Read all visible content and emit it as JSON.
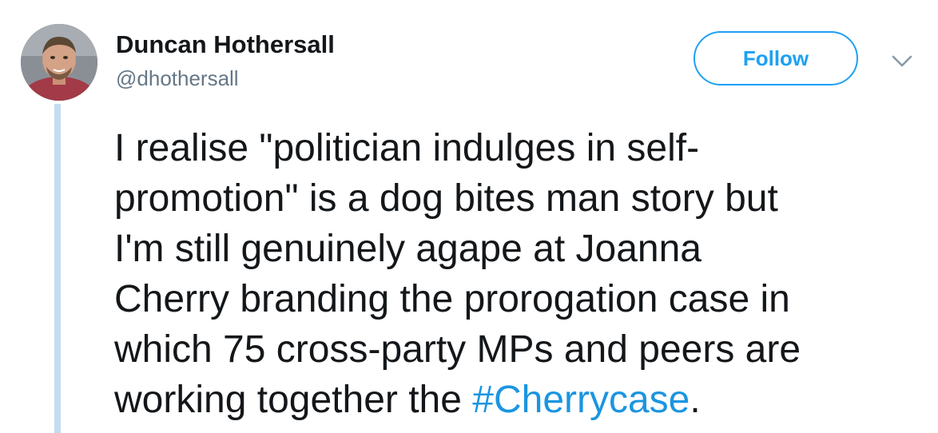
{
  "author": {
    "display_name": "Duncan Hothersall",
    "handle": "@dhothersall"
  },
  "follow_button": {
    "label": "Follow"
  },
  "menu": {
    "icon": "chevron-down-icon"
  },
  "tweet": {
    "lines": [
      "I realise \"politician indulges in self-",
      "promotion\" is a dog bites man story but",
      "I'm still genuinely agape at Joanna",
      "Cherry branding the prorogation case in",
      "which 75 cross-party MPs and peers are"
    ],
    "last_line_prefix": "working together the ",
    "hashtag": "#Cherrycase",
    "last_line_suffix": "."
  },
  "colors": {
    "accent": "#1da1f2",
    "hashtag": "#1b95e0",
    "text": "#14171a",
    "secondary_text": "#657786",
    "thread_line": "#c4dcf1"
  }
}
